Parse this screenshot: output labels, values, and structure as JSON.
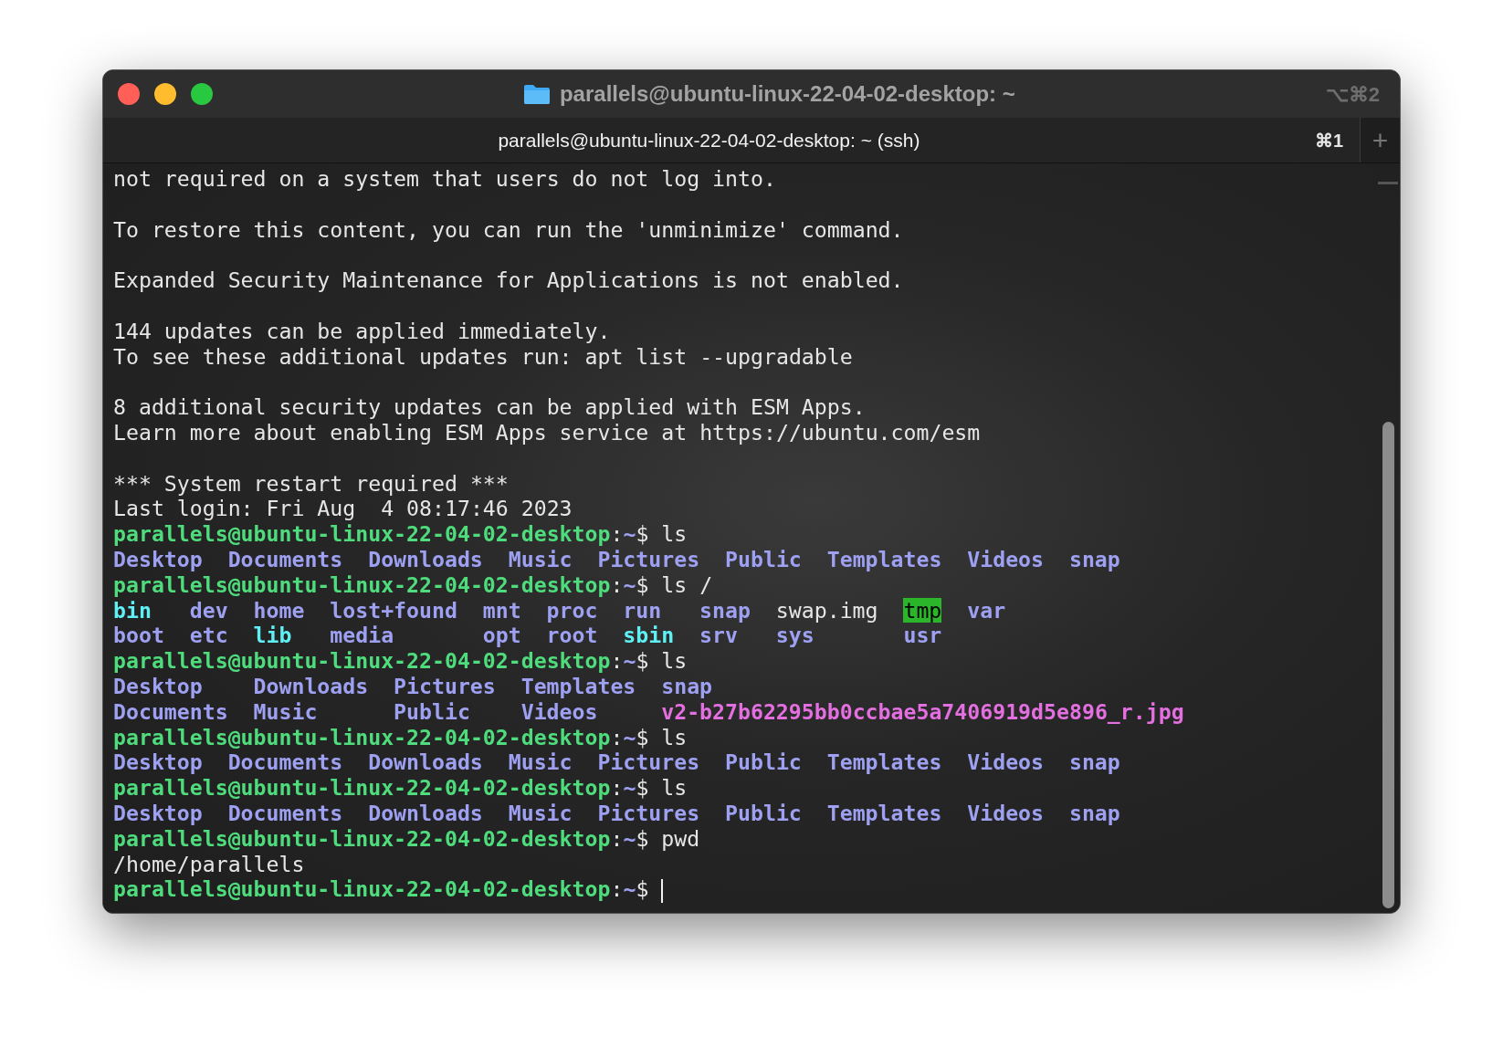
{
  "window": {
    "title": "parallels@ubuntu-linux-22-04-02-desktop: ~",
    "shortcut": "⌥⌘2"
  },
  "tabs": [
    {
      "label": "parallels@ubuntu-linux-22-04-02-desktop: ~ (ssh)",
      "shortcut": "⌘1",
      "selected": true
    }
  ],
  "new_tab_button": "+",
  "terminal": {
    "lines": [
      {
        "kind": "text",
        "text": "not required on a system that users do not log into."
      },
      {
        "kind": "blank"
      },
      {
        "kind": "text",
        "text": "To restore this content, you can run the 'unminimize' command."
      },
      {
        "kind": "blank"
      },
      {
        "kind": "text",
        "text": "Expanded Security Maintenance for Applications is not enabled."
      },
      {
        "kind": "blank"
      },
      {
        "kind": "text",
        "text": "144 updates can be applied immediately."
      },
      {
        "kind": "text",
        "text": "To see these additional updates run: apt list --upgradable"
      },
      {
        "kind": "blank"
      },
      {
        "kind": "text",
        "text": "8 additional security updates can be applied with ESM Apps."
      },
      {
        "kind": "text",
        "text": "Learn more about enabling ESM Apps service at https://ubuntu.com/esm"
      },
      {
        "kind": "blank"
      },
      {
        "kind": "text",
        "text": "*** System restart required ***"
      },
      {
        "kind": "text",
        "text": "Last login: Fri Aug  4 08:17:46 2023"
      },
      {
        "kind": "prompt",
        "host": "parallels@ubuntu-linux-22-04-02-desktop",
        "colon": ":",
        "path": "~",
        "sigil": "$",
        "command": "ls"
      },
      {
        "kind": "listing",
        "rows": [
          [
            {
              "name": "Desktop",
              "kind": "dir"
            },
            {
              "name": "Documents",
              "kind": "dir"
            },
            {
              "name": "Downloads",
              "kind": "dir"
            },
            {
              "name": "Music",
              "kind": "dir"
            },
            {
              "name": "Pictures",
              "kind": "dir"
            },
            {
              "name": "Public",
              "kind": "dir"
            },
            {
              "name": "Templates",
              "kind": "dir"
            },
            {
              "name": "Videos",
              "kind": "dir"
            },
            {
              "name": "snap",
              "kind": "dir"
            }
          ]
        ]
      },
      {
        "kind": "prompt",
        "host": "parallels@ubuntu-linux-22-04-02-desktop",
        "colon": ":",
        "path": "~",
        "sigil": "$",
        "command": "ls /"
      },
      {
        "kind": "listing",
        "rows": [
          [
            {
              "name": "bin",
              "kind": "link"
            },
            {
              "name": "dev",
              "kind": "dir"
            },
            {
              "name": "home",
              "kind": "dir"
            },
            {
              "name": "lost+found",
              "kind": "dir"
            },
            {
              "name": "mnt",
              "kind": "dir"
            },
            {
              "name": "proc",
              "kind": "dir"
            },
            {
              "name": "run",
              "kind": "dir"
            },
            {
              "name": "snap",
              "kind": "dir"
            },
            {
              "name": "swap.img",
              "kind": "file"
            },
            {
              "name": "tmp",
              "kind": "sticky"
            },
            {
              "name": "var",
              "kind": "dir"
            }
          ],
          [
            {
              "name": "boot",
              "kind": "dir"
            },
            {
              "name": "etc",
              "kind": "dir"
            },
            {
              "name": "lib",
              "kind": "link"
            },
            {
              "name": "media",
              "kind": "dir"
            },
            {
              "name": "opt",
              "kind": "dir"
            },
            {
              "name": "root",
              "kind": "dir"
            },
            {
              "name": "sbin",
              "kind": "link"
            },
            {
              "name": "srv",
              "kind": "dir"
            },
            {
              "name": "sys",
              "kind": "dir"
            },
            {
              "name": "usr",
              "kind": "dir"
            }
          ]
        ]
      },
      {
        "kind": "prompt",
        "host": "parallels@ubuntu-linux-22-04-02-desktop",
        "colon": ":",
        "path": "~",
        "sigil": "$",
        "command": "ls"
      },
      {
        "kind": "listing",
        "rows": [
          [
            {
              "name": "Desktop",
              "kind": "dir"
            },
            {
              "name": "Downloads",
              "kind": "dir"
            },
            {
              "name": "Pictures",
              "kind": "dir"
            },
            {
              "name": "Templates",
              "kind": "dir"
            },
            {
              "name": "snap",
              "kind": "dir"
            }
          ],
          [
            {
              "name": "Documents",
              "kind": "dir"
            },
            {
              "name": "Music",
              "kind": "dir"
            },
            {
              "name": "Public",
              "kind": "dir"
            },
            {
              "name": "Videos",
              "kind": "dir"
            },
            {
              "name": "v2-b27b62295bb0ccbae5a7406919d5e896_r.jpg",
              "kind": "image"
            }
          ]
        ]
      },
      {
        "kind": "prompt",
        "host": "parallels@ubuntu-linux-22-04-02-desktop",
        "colon": ":",
        "path": "~",
        "sigil": "$",
        "command": "ls"
      },
      {
        "kind": "listing",
        "rows": [
          [
            {
              "name": "Desktop",
              "kind": "dir"
            },
            {
              "name": "Documents",
              "kind": "dir"
            },
            {
              "name": "Downloads",
              "kind": "dir"
            },
            {
              "name": "Music",
              "kind": "dir"
            },
            {
              "name": "Pictures",
              "kind": "dir"
            },
            {
              "name": "Public",
              "kind": "dir"
            },
            {
              "name": "Templates",
              "kind": "dir"
            },
            {
              "name": "Videos",
              "kind": "dir"
            },
            {
              "name": "snap",
              "kind": "dir"
            }
          ]
        ]
      },
      {
        "kind": "prompt",
        "host": "parallels@ubuntu-linux-22-04-02-desktop",
        "colon": ":",
        "path": "~",
        "sigil": "$",
        "command": "ls"
      },
      {
        "kind": "listing",
        "rows": [
          [
            {
              "name": "Desktop",
              "kind": "dir"
            },
            {
              "name": "Documents",
              "kind": "dir"
            },
            {
              "name": "Downloads",
              "kind": "dir"
            },
            {
              "name": "Music",
              "kind": "dir"
            },
            {
              "name": "Pictures",
              "kind": "dir"
            },
            {
              "name": "Public",
              "kind": "dir"
            },
            {
              "name": "Templates",
              "kind": "dir"
            },
            {
              "name": "Videos",
              "kind": "dir"
            },
            {
              "name": "snap",
              "kind": "dir"
            }
          ]
        ]
      },
      {
        "kind": "prompt",
        "host": "parallels@ubuntu-linux-22-04-02-desktop",
        "colon": ":",
        "path": "~",
        "sigil": "$",
        "command": "pwd"
      },
      {
        "kind": "text",
        "text": "/home/parallels"
      },
      {
        "kind": "prompt",
        "host": "parallels@ubuntu-linux-22-04-02-desktop",
        "colon": ":",
        "path": "~",
        "sigil": "$",
        "cursor": true
      }
    ]
  }
}
